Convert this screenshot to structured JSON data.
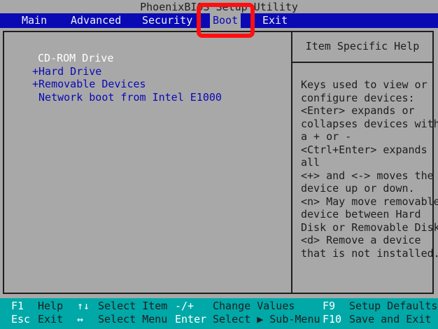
{
  "title": "PhoenixBIOS Setup Utility",
  "menu": {
    "items": [
      {
        "label": "Main"
      },
      {
        "label": "Advanced"
      },
      {
        "label": "Security"
      },
      {
        "label": "Boot"
      },
      {
        "label": "Exit"
      }
    ],
    "active": "Boot"
  },
  "boot_list": [
    {
      "label": "CD-ROM Drive"
    },
    {
      "label": "+Hard Drive"
    },
    {
      "label": "+Removable Devices"
    },
    {
      "label": " Network boot from Intel E1000"
    }
  ],
  "help": {
    "title": "Item Specific Help",
    "lines": [
      "Keys used to view or",
      "configure devices:",
      "<Enter> expands or",
      "collapses devices with",
      "a + or -",
      "<Ctrl+Enter> expands",
      "all",
      "<+> and <-> moves the",
      "device up or down.",
      "<n> May move removable",
      "device between Hard",
      "Disk or Removable Disk",
      "<d> Remove a device",
      "that is not installed."
    ]
  },
  "status": {
    "row1": {
      "f1_key": "F1",
      "f1_desc": "Help",
      "updown_key": "↑↓",
      "updown_desc": "Select Item",
      "plusminus_key": "-/+",
      "plusminus_desc": "Change Values",
      "f9_key": "F9",
      "f9_desc": "Setup Defaults"
    },
    "row2": {
      "esc_key": "Esc",
      "esc_desc": "Exit",
      "leftright_key": "↔",
      "leftright_desc": "Select Menu",
      "enter_key": "Enter",
      "enter_desc": "Select ▶ Sub-Menu",
      "f10_key": "F10",
      "f10_desc": "Save and Exit"
    }
  },
  "colors": {
    "background": "#a8a8a8",
    "menubar": "#0a0ab4",
    "statusbar": "#00a8a8",
    "highlight_box": "#ff1010"
  }
}
